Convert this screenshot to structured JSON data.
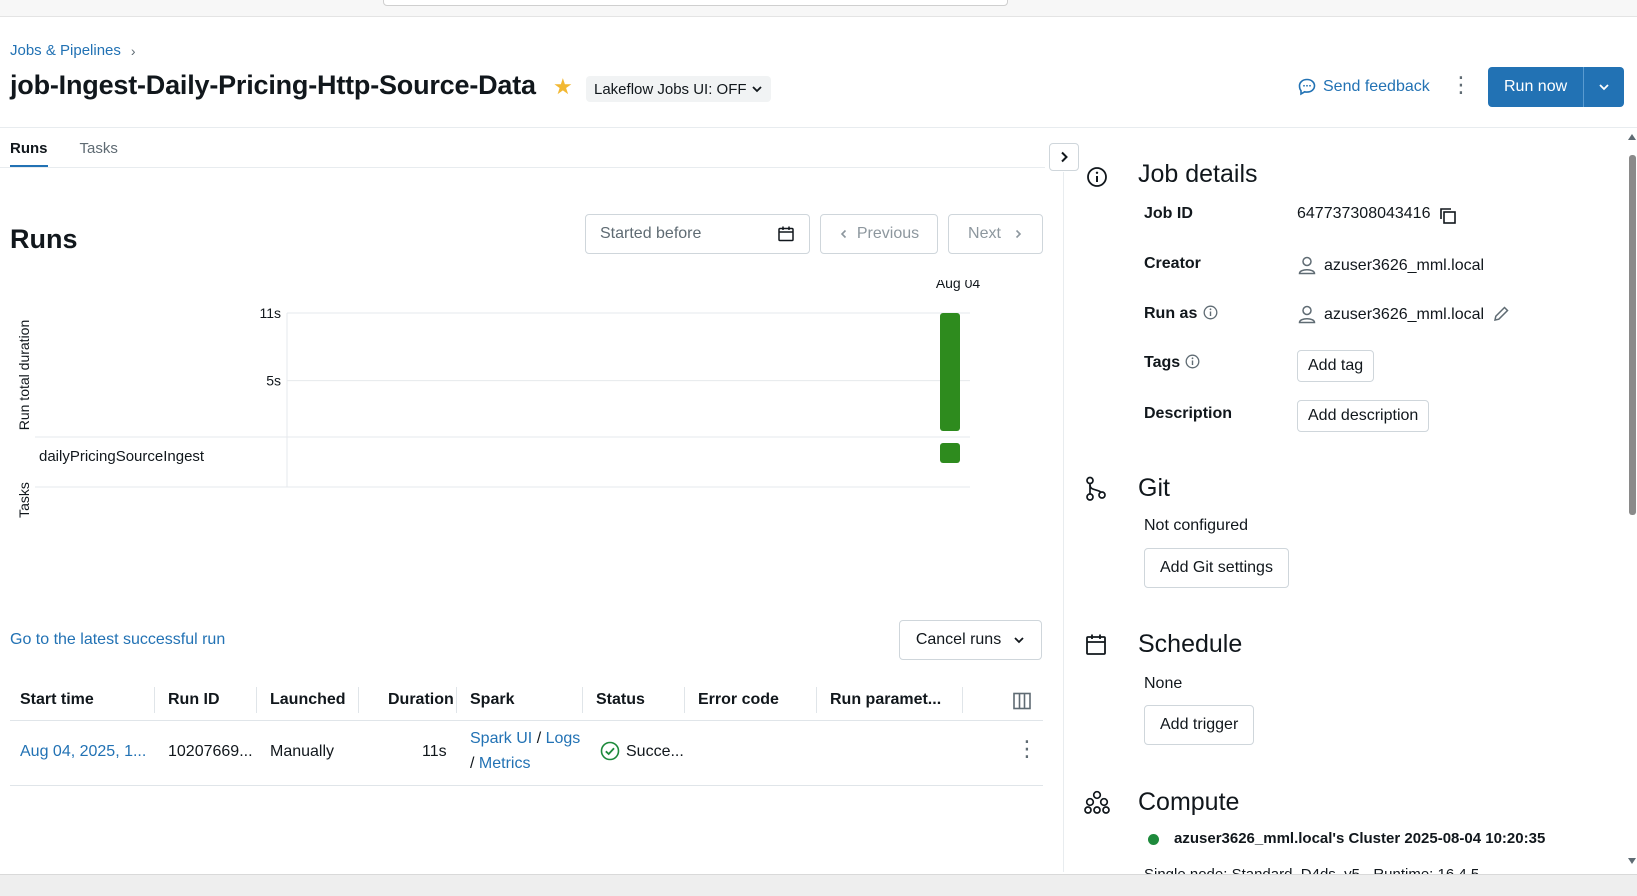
{
  "breadcrumb": {
    "label": "Jobs & Pipelines"
  },
  "header": {
    "title": "job-Ingest-Daily-Pricing-Http-Source-Data",
    "lakeflow_toggle": "Lakeflow Jobs UI: OFF",
    "send_feedback": "Send feedback",
    "run_now": "Run now"
  },
  "tabs": [
    {
      "label": "Runs"
    },
    {
      "label": "Tasks"
    }
  ],
  "runs": {
    "heading": "Runs",
    "started_before_placeholder": "Started before",
    "previous": "Previous",
    "next": "Next",
    "latest_link": "Go to the latest successful run",
    "cancel_runs": "Cancel runs"
  },
  "chart_data": {
    "type": "bar",
    "categories": [
      "Aug 04"
    ],
    "series": [
      {
        "values": [
          11
        ]
      }
    ],
    "ylabel": "Run total duration",
    "yticks": [
      "11s",
      "5s"
    ],
    "ylim": [
      0,
      11
    ],
    "tasks_label": "Tasks",
    "tasks": [
      {
        "name": "dailyPricingSourceIngest",
        "status": "success"
      }
    ],
    "bar_color": "#2e8b1e"
  },
  "table": {
    "columns": [
      "Start time",
      "Run ID",
      "Launched",
      "Duration",
      "Spark",
      "Status",
      "Error code",
      "Run paramet..."
    ],
    "rows": [
      {
        "start_time": "Aug 04, 2025, 1...",
        "run_id": "10207669...",
        "launched": "Manually",
        "duration": "11s",
        "spark_ui": "Spark UI",
        "sep1": "/",
        "logs": "Logs",
        "sep2": "/",
        "metrics": "Metrics",
        "status": "Succe..."
      }
    ]
  },
  "details": {
    "title": "Job details",
    "job_id_label": "Job ID",
    "job_id": "647737308043416",
    "creator_label": "Creator",
    "creator": "azuser3626_mml.local",
    "run_as_label": "Run as",
    "run_as": "azuser3626_mml.local",
    "tags_label": "Tags",
    "add_tag": "Add tag",
    "description_label": "Description",
    "add_description": "Add description"
  },
  "git": {
    "title": "Git",
    "status": "Not configured",
    "button": "Add Git settings"
  },
  "schedule": {
    "title": "Schedule",
    "status": "None",
    "button": "Add trigger"
  },
  "compute": {
    "title": "Compute",
    "cluster": "azuser3626_mml.local's Cluster 2025-08-04 10:20:35",
    "cluster_detail": "Single node: Standard_D4ds_v5 · Runtime: 16.4.5",
    "status_color": "#1e8a3c"
  }
}
